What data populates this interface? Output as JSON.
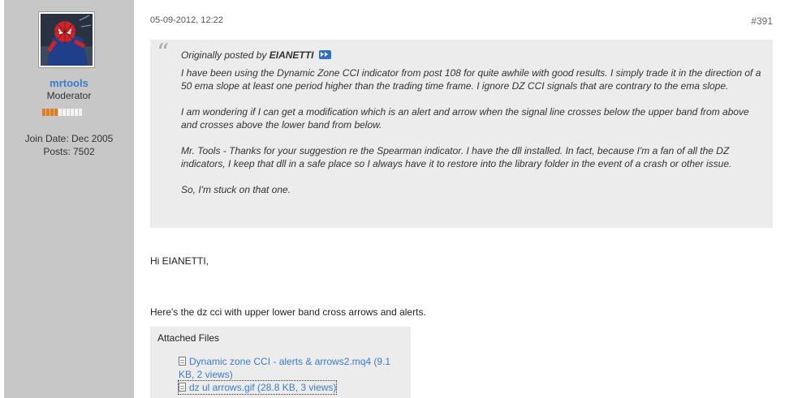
{
  "user": {
    "username": "mrtools",
    "title": "Moderator",
    "reputation_segments": 10,
    "reputation_filled": 4,
    "join_date": "Join Date: Dec 2005",
    "posts": "Posts: 7502"
  },
  "post": {
    "date": "05-09-2012, 12:22",
    "number": "#391"
  },
  "quote": {
    "prefix": "Originally posted by",
    "author": "EIANETTI",
    "view_post_icon": "view-post-icon",
    "paragraphs": [
      "I have been using the Dynamic Zone CCI indicator from post 108 for quite awhile with good results. I simply trade it in the direction of a 50 ema slope at least one period higher than the trading time frame. I ignore DZ CCI signals that are contrary to the ema slope.",
      "I am wondering if I can get a modification which is an alert and arrow when the signal line crosses below the upper band from above and crosses above the lower band from below.",
      "Mr. Tools - Thanks for your suggestion re the Spearman indicator. I have the dll installed. In fact, because I'm a fan of all the DZ indicators, I keep that dll in a safe place so I always have it to restore into the library folder in the event of a crash or other issue.",
      "So, I'm stuck on that one."
    ]
  },
  "message": {
    "greeting": "Hi EIANETTI,",
    "body": "Here's the dz cci with upper lower band cross arrows and alerts."
  },
  "attachments": {
    "title": "Attached Files",
    "files": [
      {
        "label": "Dynamic zone CCI - alerts & arrows2.mq4 (9.1 KB, 2 views)"
      },
      {
        "label": "dz ul arrows.gif (28.8 KB, 3 views)"
      }
    ]
  },
  "colors": {
    "sidebar": "#c7c7c7",
    "link": "#3b7cc9",
    "quote_bg": "#ececec",
    "rep_filled": "#e07c1a",
    "rep_empty": "#f3f3f3"
  }
}
